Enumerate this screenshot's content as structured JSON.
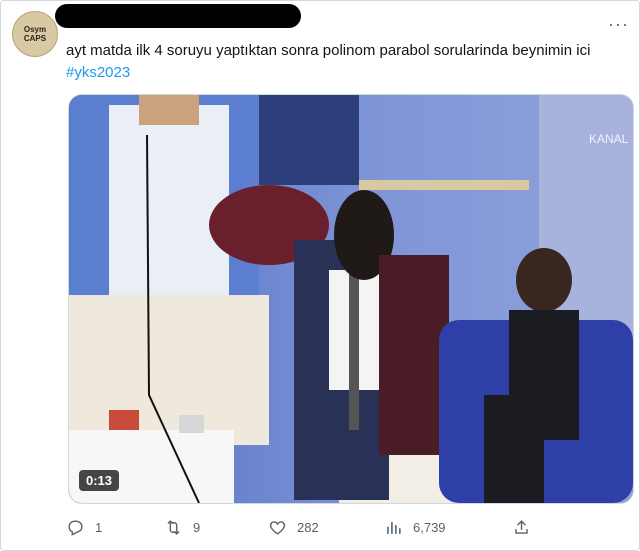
{
  "tweet": {
    "avatar_text": "Osym CAPS",
    "text": "ayt matda ilk 4 soruyu yaptıktan sonra polinom parabol sorularinda beynimin ici ",
    "hashtag": "#yks2023"
  },
  "media": {
    "duration": "0:13",
    "watermark": "KANAL"
  },
  "actions": {
    "replies": "1",
    "retweets": "9",
    "likes": "282",
    "views": "6,739"
  },
  "icons": [
    "reply-icon",
    "retweet-icon",
    "like-icon",
    "views-icon",
    "share-icon",
    "more-icon"
  ]
}
